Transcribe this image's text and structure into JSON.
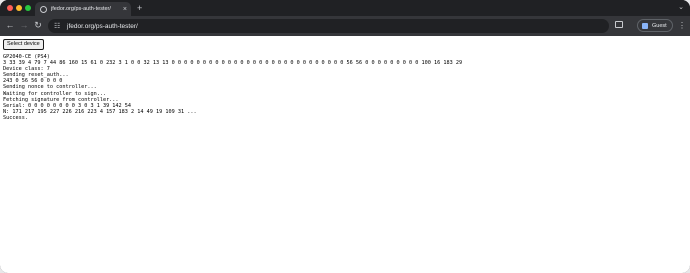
{
  "browser": {
    "tab": {
      "title": "jfedor.org/ps-auth-tester/",
      "favicon": "globe-icon"
    },
    "address_bar": {
      "url": "jfedor.org/ps-auth-tester/"
    },
    "profile": {
      "label": "Guest"
    },
    "colors": {
      "frame": "#202124",
      "toolbar": "#35363a",
      "text": "#e8eaed"
    }
  },
  "page": {
    "select_button_label": "Select device",
    "log_lines": [
      "GP2040-CE (PS4)",
      "3 33 39 4 79 7 44 86 160 15 61 0 232 3 1 0 0 32 13 13 0 0 0 0 0 0 0 0 0 0 0 0 0 0 0 0 0 0 0 0 0 0 0 0 0 0 0 0 56 56 0 0 0 0 0 0 0 0 0 100 16 183 29",
      "Device class: 7",
      "Sending reset_auth...",
      "243 0 56 56 0 0 0 0",
      "Sending nonce to controller...",
      "Waiting for controller to sign...",
      "Fetching signature from controller...",
      "Serial: 0 0 0 0 0 0 0 0 3 0 3 1 39 142 54",
      "N: 171 217 195 227 226 216 223 4 157 183 2 14 49 19 109 31 ...",
      "Success."
    ]
  }
}
